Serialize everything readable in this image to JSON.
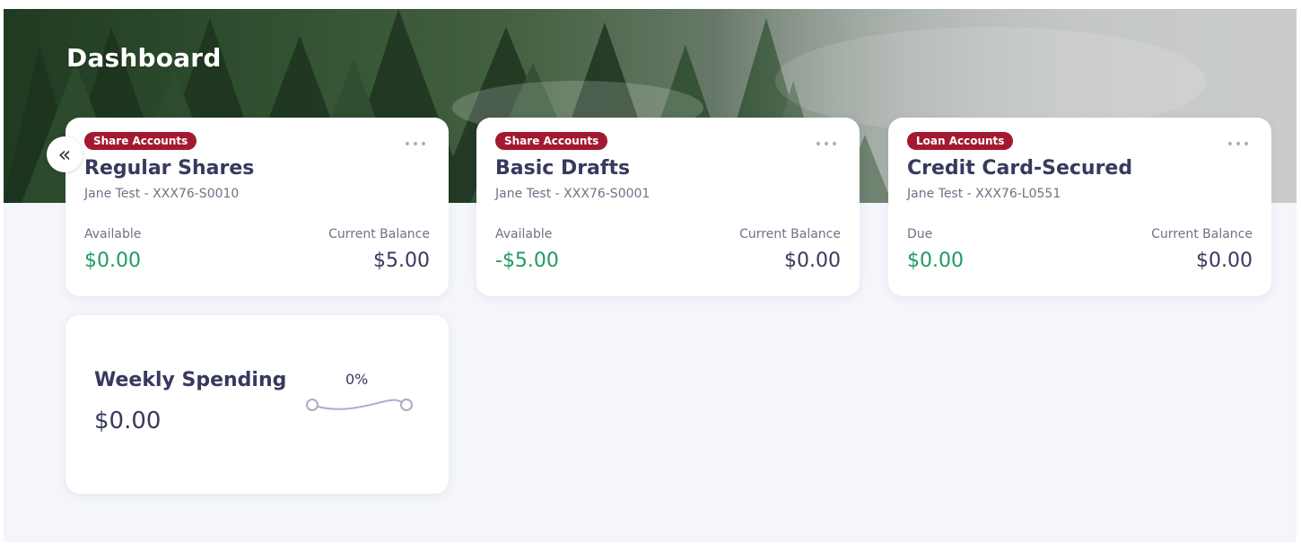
{
  "header": {
    "title": "Dashboard",
    "collapse_glyph": "«",
    "colors": {
      "banner_start": "#1f3b22",
      "banner_end": "#b5b8b6"
    }
  },
  "accounts": [
    {
      "badge": "Share Accounts",
      "name": "Regular Shares",
      "subtitle": "Jane Test - XXX76-S0010",
      "left_label": "Available",
      "left_value": "$0.00",
      "right_label": "Current Balance",
      "right_value": "$5.00"
    },
    {
      "badge": "Share Accounts",
      "name": "Basic Drafts",
      "subtitle": "Jane Test - XXX76-S0001",
      "left_label": "Available",
      "left_value": "-$5.00",
      "right_label": "Current Balance",
      "right_value": "$0.00"
    },
    {
      "badge": "Loan Accounts",
      "name": "Credit Card-Secured",
      "subtitle": "Jane Test - XXX76-L0551",
      "left_label": "Due",
      "left_value": "$0.00",
      "right_label": "Current Balance",
      "right_value": "$0.00"
    }
  ],
  "weekly_spending": {
    "title": "Weekly Spending",
    "amount": "$0.00",
    "change_percent": "0%"
  },
  "colors": {
    "badge": "#a3192f",
    "positive_value": "#1f9a63",
    "text_primary": "#373a5e",
    "text_secondary": "#6f7285",
    "page_background": "#f4f6fb"
  },
  "icons": {
    "collapse": "double-chevron-left-icon",
    "card_menu": "more-horizontal-icon",
    "sparkline": "sparkline-icon"
  }
}
